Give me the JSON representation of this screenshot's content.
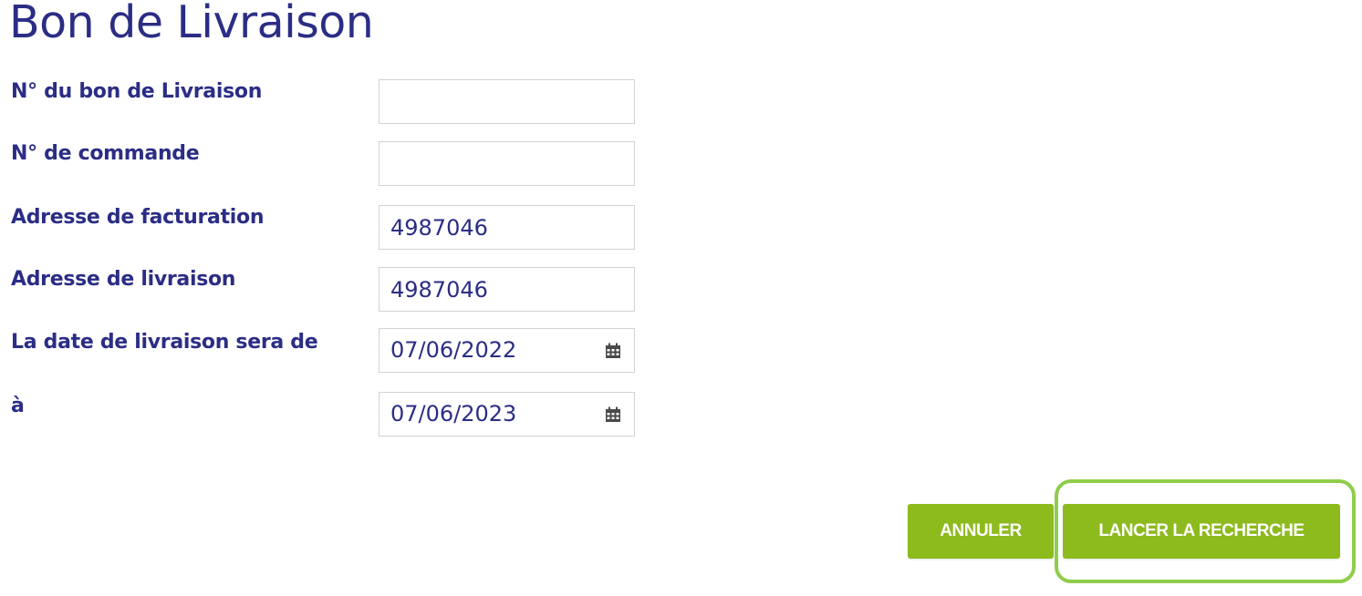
{
  "page": {
    "title": "Bon de Livraison"
  },
  "form": {
    "fields": [
      {
        "label": "N° du bon de Livraison",
        "value": "",
        "type": "text"
      },
      {
        "label": "N° de commande",
        "value": "",
        "type": "text"
      },
      {
        "label": "Adresse de facturation",
        "value": "4987046",
        "type": "text"
      },
      {
        "label": "Adresse de livraison",
        "value": "4987046",
        "type": "text"
      },
      {
        "label": "La date de livraison sera de",
        "value": "07/06/2022",
        "type": "date",
        "icon": "calendar-icon"
      },
      {
        "label": "à",
        "value": "07/06/2023",
        "type": "date",
        "icon": "calendar-icon"
      }
    ]
  },
  "actions": {
    "cancel_label": "ANNULER",
    "search_label": "LANCER LA RECHERCHE"
  },
  "colors": {
    "title": "#2b2d85",
    "label": "#2b2d85",
    "button": "#8dba1d",
    "focus_ring": "#8fcd4a"
  }
}
